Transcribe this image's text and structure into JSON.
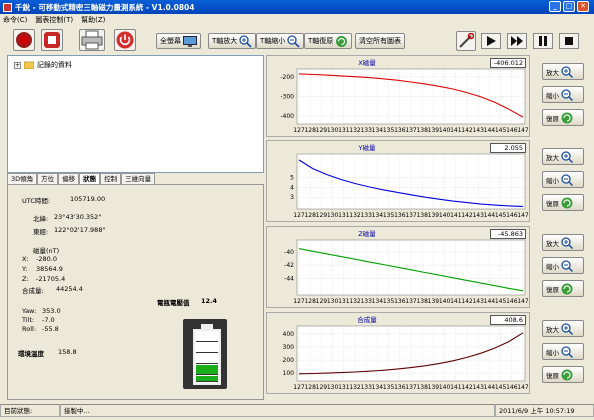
{
  "window": {
    "title": "千銳 - 可移動式精密三軸磁力量測系統 - V1.0.0804",
    "minimize": "_",
    "maximize": "□",
    "close": "✕"
  },
  "menu": [
    "命令(C)",
    "圖表控制(T)",
    "幫助(Z)"
  ],
  "toolbar": {
    "fullscreen": "全螢幕",
    "t_zoom_in": "T軸放大",
    "t_zoom_out": "T軸縮小",
    "t_restore": "T軸復原",
    "clear_all": "清空所有圖表"
  },
  "tree": {
    "root_label": "記錄的資料"
  },
  "tabs": [
    "3D傾角",
    "方位",
    "偏移",
    "狀態",
    "控制",
    "三維向量"
  ],
  "active_tab": "狀態",
  "status": {
    "utc_label": "UTC時間:",
    "utc_value": "105719.00",
    "lat_label": "北緯:",
    "lat_value": "23°43'30.352\"",
    "lon_label": "東經:",
    "lon_value": "122°02'17.988\"",
    "mag_label": "磁量(nT)",
    "x_label": "X:",
    "x_value": "-280.0",
    "y_label": "Y:",
    "y_value": "38564.9",
    "z_label": "Z:",
    "z_value": "-21705.4",
    "total_label": "合成量:",
    "total_value": "44254.4",
    "yaw_label": "Yaw:",
    "yaw_value": "353.0",
    "tilt_label": "Tilt:",
    "tilt_value": "-7.0",
    "roll_label": "Roll:",
    "roll_value": "-55.8",
    "battery_label": "電瓶電壓值",
    "battery_value": "12.4",
    "temp_label": "環境溫度",
    "temp_value": "158.8",
    "battery_level": 0.4
  },
  "charts": [
    {
      "title": "X磁量",
      "value": "-406.012",
      "color": "#e00000",
      "yticks": [
        "-200",
        "-300",
        "-400"
      ],
      "ymin": -440,
      "ymax": -160,
      "y": [
        -185,
        -188,
        -191,
        -195,
        -199,
        -204,
        -210,
        -217,
        -226,
        -236,
        -248,
        -262,
        -280,
        -302,
        -330,
        -365,
        -405
      ]
    },
    {
      "title": "Y磁量",
      "value": "2.055",
      "color": "#0000e0",
      "yticks": [
        "5",
        "4",
        "3"
      ],
      "ymin": 1.8,
      "ymax": 7.4,
      "y": [
        6.8,
        5.9,
        5.3,
        4.8,
        4.4,
        4.05,
        3.75,
        3.5,
        3.25,
        3.0,
        2.8,
        2.6,
        2.45,
        2.3,
        2.2,
        2.12,
        2.06
      ]
    },
    {
      "title": "Z磁量",
      "value": "-45.863",
      "color": "#00a000",
      "yticks": [
        "-40",
        "-42",
        "-44"
      ],
      "ymin": -46.5,
      "ymax": -38.2,
      "y": [
        -39.5,
        -39.9,
        -40.3,
        -40.7,
        -41.1,
        -41.5,
        -41.9,
        -42.3,
        -42.7,
        -43.1,
        -43.5,
        -43.9,
        -44.3,
        -44.7,
        -45.1,
        -45.5,
        -45.86
      ]
    },
    {
      "title": "合成量",
      "value": "408.6",
      "color": "#600000",
      "yticks": [
        "400",
        "300",
        "200",
        "100"
      ],
      "ymin": 40,
      "ymax": 460,
      "y": [
        95,
        97,
        100,
        104,
        109,
        115,
        122,
        131,
        142,
        156,
        173,
        194,
        220,
        252,
        292,
        342,
        408
      ]
    }
  ],
  "chart_xticks": [
    "127",
    "128",
    "129",
    "130",
    "131",
    "132",
    "133",
    "134",
    "135",
    "136",
    "137",
    "138",
    "139",
    "140",
    "141",
    "142",
    "143",
    "144",
    "145",
    "146",
    "147"
  ],
  "side_buttons": {
    "zoom_in": "放大",
    "zoom_out": "縮小",
    "restore": "復原"
  },
  "statusbar": {
    "label": "目前狀態:",
    "value": "接製中...",
    "datetime": "2011/6/9 上午 10:57:19"
  }
}
